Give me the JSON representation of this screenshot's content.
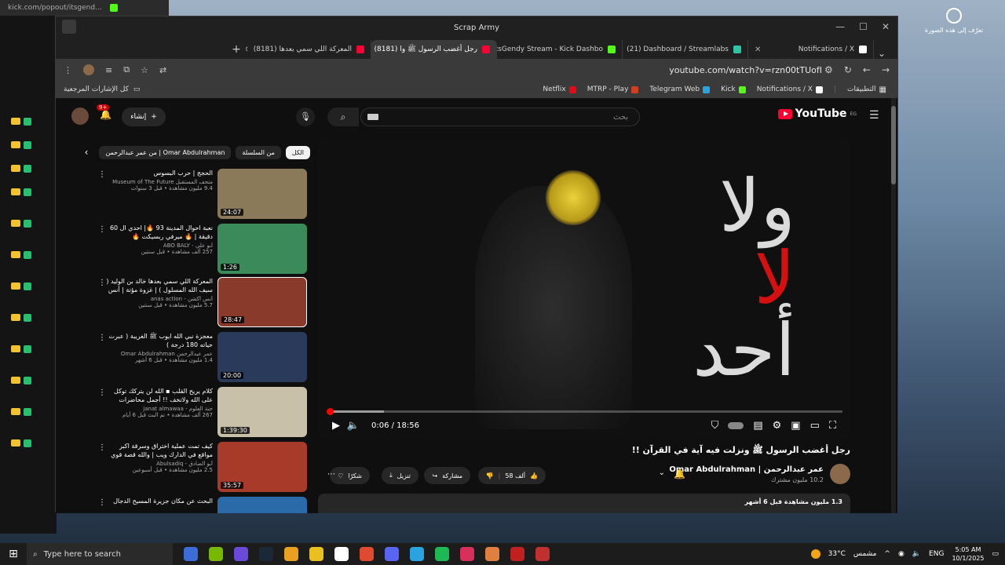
{
  "popout": {
    "url": "kick.com/popout/itsgend..."
  },
  "window": {
    "title": "Scrap Army"
  },
  "tabs": [
    {
      "label": "(8181) المعركة اللي سمي بعدها",
      "fav": "#ff0033"
    },
    {
      "label": "(8181) رجل أغضب الرسول ﷺ وا",
      "fav": "#ff0033",
      "active": true
    },
    {
      "label": "itsGendy Stream - Kick Dashbo",
      "fav": "#53fc18"
    },
    {
      "label": "(21) Dashboard / Streamlabs",
      "fav": "#31c3a2"
    },
    {
      "label": "Notifications / X",
      "fav": "#ffffff"
    }
  ],
  "address": {
    "url": "youtube.com/watch?v=rzn00tTUofI"
  },
  "bookmarks": {
    "folder": "كل الإشارات المرجعية",
    "items": [
      {
        "label": "Netflix",
        "color": "#e50914"
      },
      {
        "label": "MTRP - Play",
        "color": "#d04020"
      },
      {
        "label": "Telegram Web",
        "color": "#2aa3e0"
      },
      {
        "label": "Kick",
        "color": "#53fc18"
      },
      {
        "label": "Notifications / X",
        "color": "#ffffff"
      }
    ],
    "apps": "التطبيقات"
  },
  "youtube": {
    "logo": "YouTube",
    "region": "EG",
    "search_placeholder": "بحث",
    "create_label": "إنشاء",
    "notif_count": "9+",
    "chips": [
      "الكل",
      "من السلسلة",
      "من عمر عبدالرحمن | Omar Abdulrahman"
    ],
    "recommendations": [
      {
        "title": "الحجج | حرب البسوس",
        "channel": "متحف المستقبل Museum of The Future",
        "stats": "9.4 مليون مشاهدة • قبل 3 سنوات",
        "duration": "24:07",
        "color": "#8a7a5a"
      },
      {
        "title": "نعبة احوال المدينة 93 🔥| احدي ال 60 دقيقة | 🔥 ميرفي ربسيكت 🔥",
        "channel": "أبو علي - ABO BALY",
        "stats": "257 ألف مشاهدة • قبل سنتين",
        "duration": "1:26",
        "color": "#3a8a5a"
      },
      {
        "title": "المعركة اللي سمي بعدها خالد بن الوليد ( سيف الله المسلول ) | غزوة مؤتة | أنس أكشن",
        "channel": "أنس أكشن - anas action",
        "stats": "5.7 مليون مشاهدة • قبل سنتين",
        "duration": "28:47",
        "color": "#8a3a2a"
      },
      {
        "title": "معجزة نبي الله ايوب ﷺ الغريبة ( عبرت حياته 180 درجة )",
        "channel": "عمر عبدالرحمن Omar Abdulrahman",
        "stats": "1.4 مليون مشاهدة • قبل 6 أشهر",
        "duration": "20:00",
        "color": "#2a3a5a"
      },
      {
        "title": "كلام يريح القلب ▪ الله لن يتركك توكل على الله ولاتخف !! أجمل محاضرات الشيخ عبد ...",
        "channel": "جنة العلوم - janat almawaa",
        "stats": "267 ألف مشاهدة • تم البث قبل 6 أيام",
        "duration": "1:39:30",
        "color": "#c8c0a8"
      },
      {
        "title": "كيف تمت عملية اختراق وسرقة اكبر مواقع في الدارك ويب | والله قصة قوي",
        "channel": "أبو الصادق - Abulsadiq",
        "stats": "2.5 مليون مشاهدة • قبل أسبوعين",
        "duration": "35:57",
        "color": "#a83a2a"
      },
      {
        "title": "البحث عن مكان جزيرة المسيح الدجال",
        "channel": "",
        "stats": "",
        "duration": "",
        "color": "#2a6aa8"
      }
    ],
    "player": {
      "time": "0:06 / 18:56",
      "progress_played": 0.003,
      "progress_loaded": 0.11,
      "calligraphy_1": "ولا",
      "calligraphy_2": "لا",
      "calligraphy_3": "أحد"
    },
    "video_title": "رجل أغضب الرسول ﷺ ونزلت فيه آية في القرآن !!",
    "channel": {
      "name": "عمر عبدالرحمن | Omar Abdulrahman",
      "subs": "10.2 مليون مشترك"
    },
    "actions": {
      "likes": "58 ألف",
      "share": "مشاركة",
      "download": "تنزيل",
      "thanks": "شكرًا"
    },
    "description": "1.3 مليون مشاهدة قبل 6 أشهر"
  },
  "desktop": {
    "right_label": "تعرّف إلى هذه الصورة"
  },
  "taskbar": {
    "search": "Type here to search",
    "temp": "33°C",
    "weather": "مشمس",
    "lang": "ENG",
    "time": "5:05 AM",
    "date": "10/1/2025"
  }
}
